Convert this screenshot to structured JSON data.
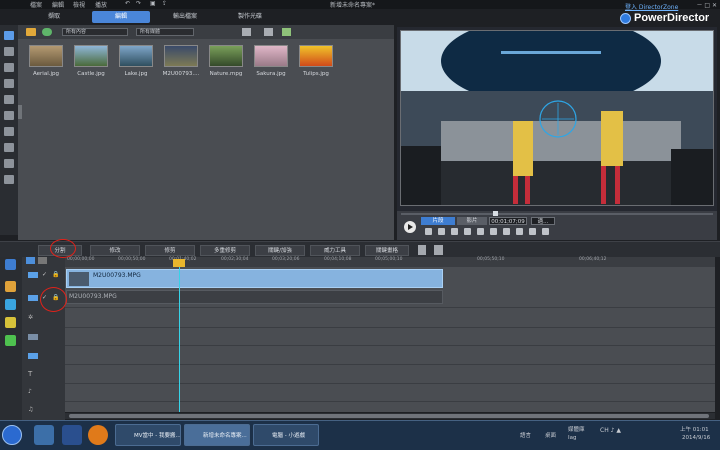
{
  "menubar": {
    "items": [
      "檔案",
      "編輯",
      "檢視",
      "播放"
    ],
    "title": "新增未命名專案*",
    "login": "登入 DirectorZone"
  },
  "brand": "PowerDirector",
  "modes": [
    {
      "label": "擷取",
      "active": false
    },
    {
      "label": "編輯",
      "active": true
    },
    {
      "label": "輸出檔案",
      "active": false
    },
    {
      "label": "製作光碟",
      "active": false
    }
  ],
  "library": {
    "filter_content": "所有內容",
    "filter_type": "所有媒體",
    "items": [
      "Aerial.jpg",
      "Castle.jpg",
      "Lake.jpg",
      "M2U00793....",
      "Nature.mpg",
      "Sakura.jpg",
      "Tulips.jpg"
    ]
  },
  "preview": {
    "segments": [
      "片段",
      "影片"
    ],
    "timecode": "00;01;07;09",
    "zoom": "適..."
  },
  "toolbar": [
    "分割",
    "修改",
    "修剪",
    "多重修剪",
    "關鍵/加強",
    "威力工具",
    "關鍵畫格"
  ],
  "timeline": {
    "ruler": [
      "00;00;00;00",
      "00;00;50;00",
      "00;01;40;02",
      "00;02;30;04",
      "00;03;20;06",
      "00;04;10;08",
      "00;05;00;10",
      "00;05;50;10",
      "00;06;40;12"
    ],
    "video_clip": "M2U00793.MPG",
    "audio_clip": "M2U00793.MPG"
  },
  "taskbar": {
    "windows": [
      "MV當中 - 我要搬...",
      "新增未命名專案...",
      "電腦 - 小遊戲"
    ],
    "tray_left": "語言",
    "tray_mid": "桌面",
    "tray_items": [
      "媒體庫",
      "Iag"
    ],
    "time": "上午 01:01",
    "date": "2014/9/16"
  },
  "colors": {
    "accent": "#4a86d9",
    "clip": "#86b3df",
    "annotation": "#e0221a",
    "playhead": "#37d3e8"
  }
}
